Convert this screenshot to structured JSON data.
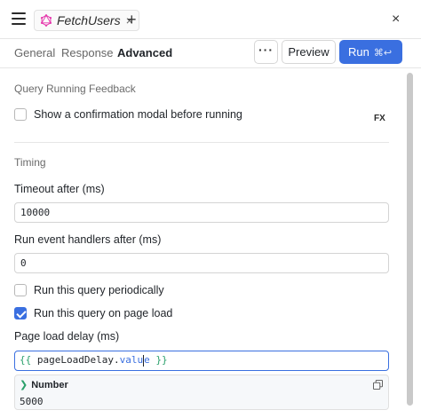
{
  "header": {
    "tab_name": "FetchUsers",
    "tab_close": "×",
    "add_tab": "+",
    "close_panel": "×"
  },
  "subtabs": [
    {
      "label": "General"
    },
    {
      "label": "Response"
    },
    {
      "label": "Advanced",
      "active": true
    }
  ],
  "toolbar": {
    "more_label": "···",
    "preview_label": "Preview",
    "run_label": "Run",
    "run_shortcut": "⌘↩"
  },
  "feedback": {
    "section_title": "Query Running Feedback",
    "confirm_label": "Show a confirmation modal before running",
    "confirm_checked": false,
    "fx_label": "FX"
  },
  "timing": {
    "section_title": "Timing",
    "timeout_label": "Timeout after (ms)",
    "timeout_value": "10000",
    "handlers_label": "Run event handlers after (ms)",
    "handlers_value": "0",
    "periodic_label": "Run this query periodically",
    "periodic_checked": false,
    "pageload_label": "Run this query on page load",
    "pageload_checked": true,
    "delay_label": "Page load delay (ms)",
    "delay_expr_open": "{{",
    "delay_expr_ident": "pageLoadDelay",
    "delay_expr_dot": ".",
    "delay_expr_prop_before": "valu",
    "delay_expr_prop_after": "e",
    "delay_expr_close": "}}",
    "preview_type": "Number",
    "preview_value": "5000"
  },
  "colors": {
    "accent": "#3a6fe0",
    "template_brace": "#2aa06b"
  }
}
